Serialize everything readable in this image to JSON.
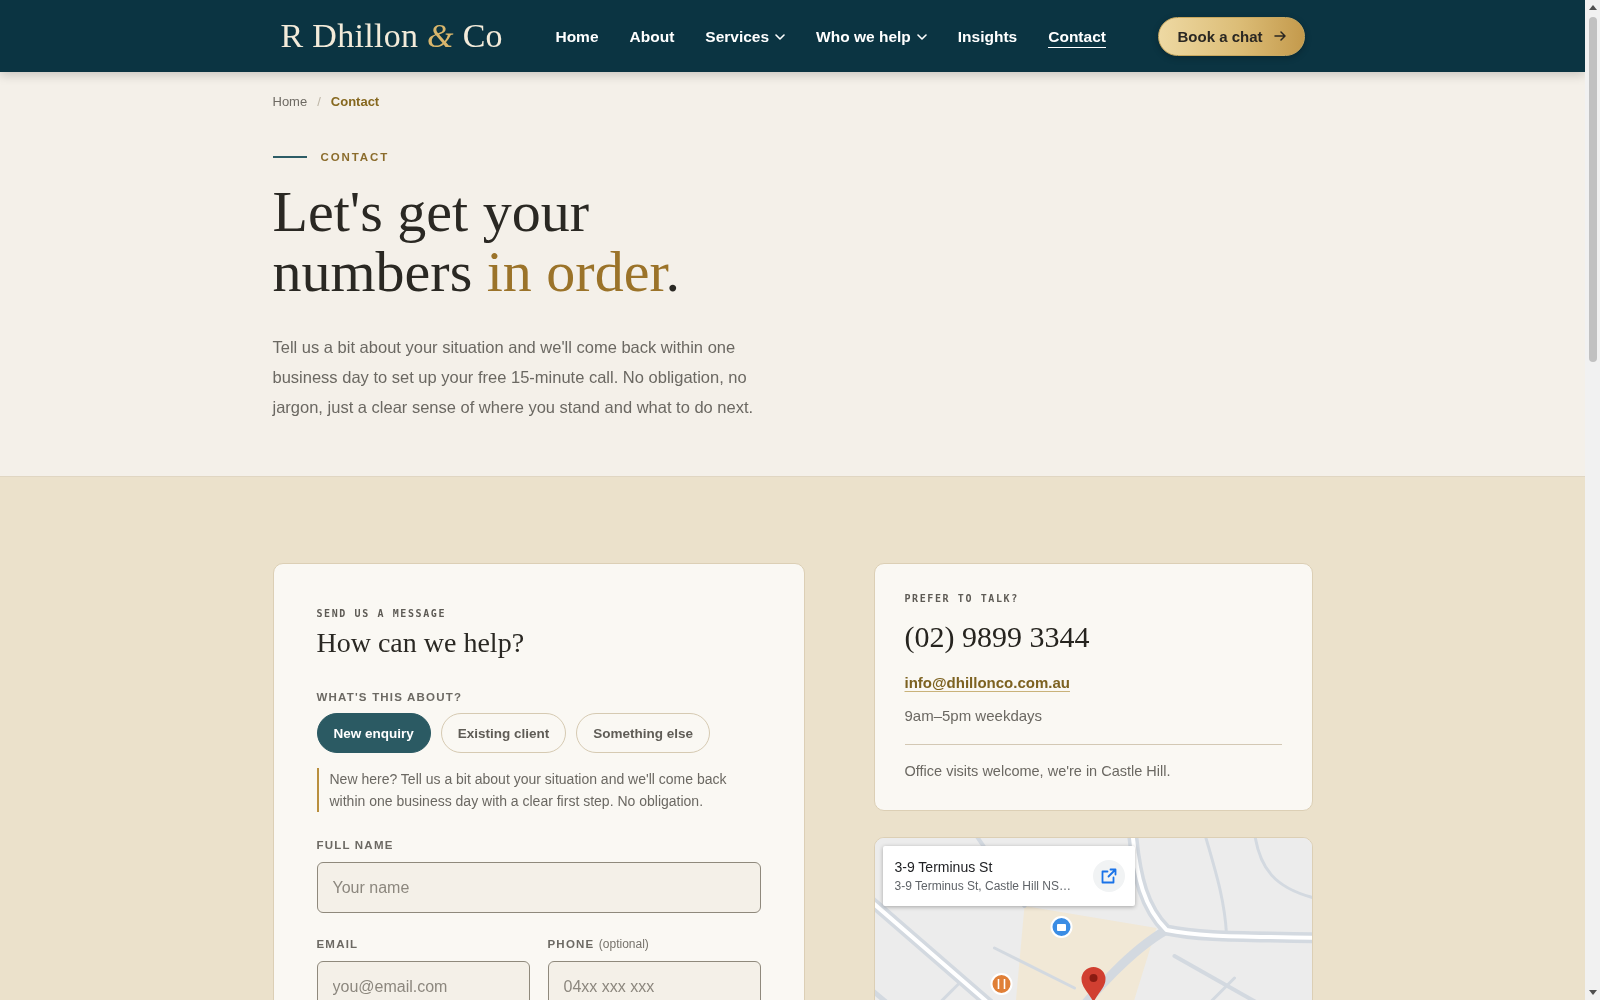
{
  "header": {
    "logo": {
      "before": "R Dhillon",
      "ampersand": "&",
      "after": "Co"
    },
    "nav": [
      {
        "label": "Home",
        "dropdown": false,
        "selected": false
      },
      {
        "label": "About",
        "dropdown": false,
        "selected": false
      },
      {
        "label": "Services",
        "dropdown": true,
        "selected": false
      },
      {
        "label": "Who we help",
        "dropdown": true,
        "selected": false
      },
      {
        "label": "Insights",
        "dropdown": false,
        "selected": false
      },
      {
        "label": "Contact",
        "dropdown": false,
        "selected": true
      }
    ],
    "cta": {
      "label": "Book a chat"
    }
  },
  "breadcrumb": {
    "items": [
      {
        "label": "Home",
        "current": false
      },
      {
        "label": "Contact",
        "current": true
      }
    ],
    "separator": "/"
  },
  "hero": {
    "eyebrow": "CONTACT",
    "title_lines": [
      {
        "segments": [
          {
            "text": "Let's get your",
            "accent": false
          }
        ]
      },
      {
        "segments": [
          {
            "text": "numbers ",
            "accent": false
          },
          {
            "text": "in order",
            "accent": true
          },
          {
            "text": ".",
            "accent": false
          }
        ]
      }
    ],
    "intro": "Tell us a bit about your situation and we'll come back within one business day to set up your free 15-minute call. No obligation, no jargon, just a clear sense of where you stand and what to do next."
  },
  "form": {
    "eyebrow": "SEND US A MESSAGE",
    "title": "How can we help?",
    "topic": {
      "label": "WHAT'S THIS ABOUT?",
      "options": [
        {
          "label": "New enquiry",
          "selected": true
        },
        {
          "label": "Existing client",
          "selected": false
        },
        {
          "label": "Something else",
          "selected": false
        }
      ]
    },
    "note": "New here? Tell us a bit about your situation and we'll come back within one business day with a clear first step. No obligation.",
    "rows": [
      {
        "fields": [
          {
            "label": "FULL NAME",
            "placeholder": "Your name"
          }
        ]
      },
      {
        "fields": [
          {
            "label": "EMAIL",
            "placeholder": "you@email.com"
          },
          {
            "label": "PHONE",
            "hint": "(optional)",
            "placeholder": "04xx xxx xxx"
          }
        ]
      }
    ]
  },
  "contact": {
    "eyebrow": "PREFER TO TALK?",
    "phone": "(02) 9899 3344",
    "email": "info@dhillonco.com.au",
    "hours": "9am–5pm weekdays",
    "note": "Office visits welcome, we're in Castle Hill."
  },
  "map": {
    "place_title": "3-9 Terminus St",
    "place_address": "3-9 Terminus St, Castle Hill NS…"
  }
}
